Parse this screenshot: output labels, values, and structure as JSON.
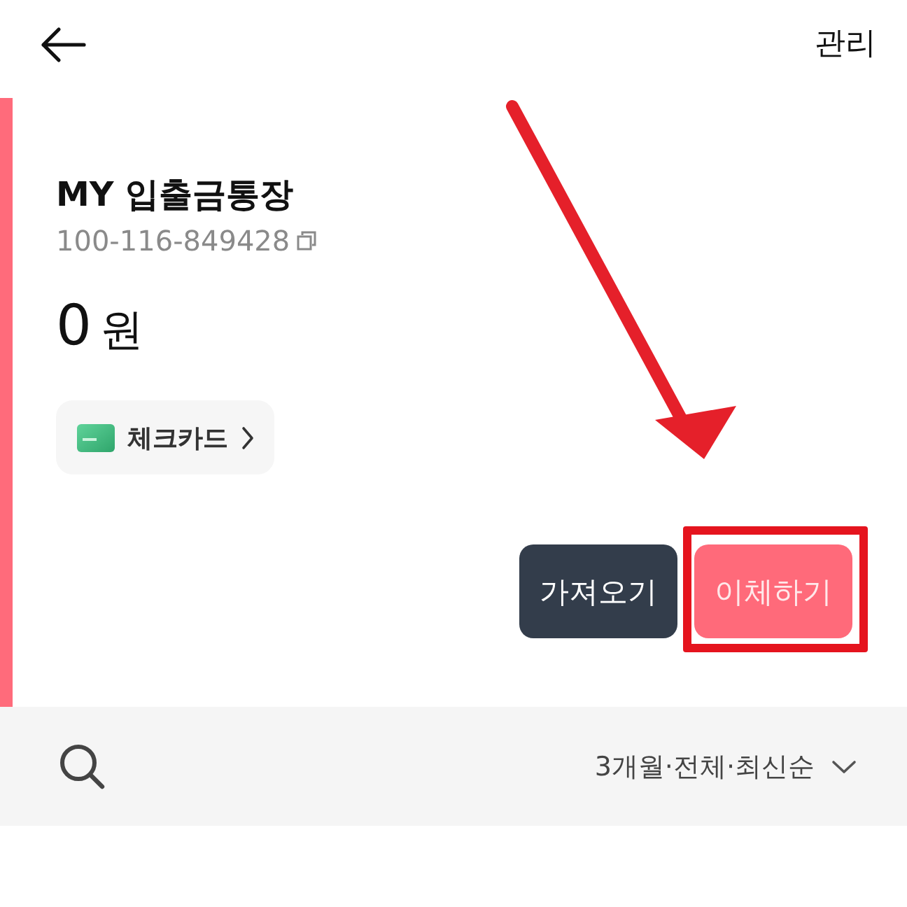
{
  "header": {
    "action": "관리"
  },
  "account": {
    "name": "MY 입출금통장",
    "number": "100-116-849428",
    "amount": "0",
    "unit": "원",
    "card_link": "체크카드"
  },
  "actions": [
    {
      "label": "가져오기",
      "kind": "secondary",
      "highlighted": false
    },
    {
      "label": "이체하기",
      "kind": "primary",
      "highlighted": true
    }
  ],
  "filter": {
    "summary": "3개월·전체·최신순"
  }
}
